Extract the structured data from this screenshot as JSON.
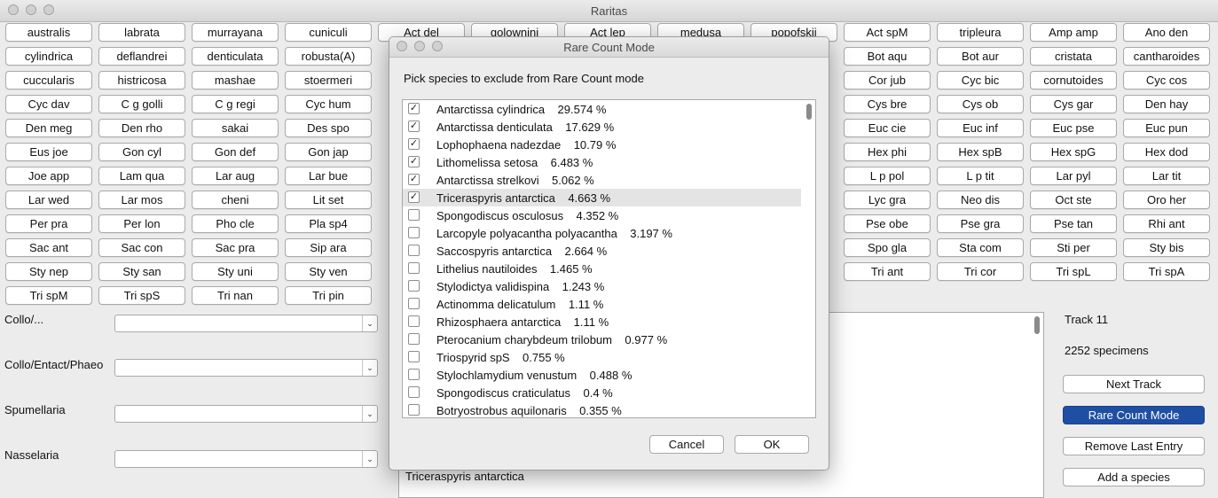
{
  "window": {
    "title": "Raritas"
  },
  "species_buttons": [
    "australis",
    "labrata",
    "murrayana",
    "cuniculi",
    "Act del",
    "golownini",
    "Act lep",
    "medusa",
    "popofskii",
    "Act spM",
    "tripleura",
    "Amp amp",
    "Ano den",
    "cylindrica",
    "deflandrei",
    "denticulata",
    "robusta(A)",
    "",
    "",
    "",
    "",
    "",
    "Bot aqu",
    "Bot aur",
    "cristata",
    "cantharoides",
    "cuccularis",
    "histricosa",
    "mashae",
    "stoermeri",
    "",
    "",
    "",
    "",
    "",
    "Cor jub",
    "Cyc bic",
    "cornutoides",
    "Cyc cos",
    "Cyc dav",
    "C g golli",
    "C g regi",
    "Cyc hum",
    "",
    "",
    "",
    "",
    "",
    "Cys bre",
    "Cys ob",
    "Cys gar",
    "Den hay",
    "Den meg",
    "Den rho",
    "sakai",
    "Des spo",
    "",
    "",
    "",
    "",
    "",
    "Euc cie",
    "Euc inf",
    "Euc pse",
    "Euc pun",
    "Eus joe",
    "Gon cyl",
    "Gon def",
    "Gon jap",
    "",
    "",
    "",
    "",
    "",
    "Hex phi",
    "Hex spB",
    "Hex spG",
    "Hex dod",
    "Joe app",
    "Lam qua",
    "Lar aug",
    "Lar bue",
    "",
    "",
    "",
    "",
    "",
    "L p pol",
    "L p tit",
    "Lar pyl",
    "Lar tit",
    "Lar wed",
    "Lar mos",
    "cheni",
    "Lit set",
    "",
    "",
    "",
    "",
    "",
    "Lyc gra",
    "Neo dis",
    "Oct ste",
    "Oro her",
    "Per pra",
    "Per lon",
    "Pho cle",
    "Pla sp4",
    "",
    "",
    "",
    "",
    "",
    "Pse obe",
    "Pse gra",
    "Pse tan",
    "Rhi ant",
    "Sac ant",
    "Sac con",
    "Sac pra",
    "Sip ara",
    "",
    "",
    "",
    "",
    "",
    "Spo gla",
    "Sta com",
    "Sti per",
    "Sty bis",
    "Sty nep",
    "Sty san",
    "Sty uni",
    "Sty ven",
    "",
    "",
    "",
    "",
    "",
    "Tri ant",
    "Tri cor",
    "Tri spL",
    "Tri spA",
    "Tri spM",
    "Tri spS",
    "Tri nan",
    "Tri pin",
    "",
    "",
    "",
    "",
    "",
    "",
    "",
    "",
    ""
  ],
  "form": {
    "fields": [
      {
        "label": "Collo/...",
        "value": ""
      },
      {
        "label": "Collo/Entact/Phaeo",
        "value": ""
      },
      {
        "label": "Spumellaria",
        "value": ""
      },
      {
        "label": "Nasselaria",
        "value": ""
      }
    ]
  },
  "log": {
    "lines": [
      "Triceraspyris antarctica"
    ]
  },
  "side": {
    "track": "Track 11",
    "specimens": "2252 specimens",
    "next_track": "Next Track",
    "rare_count_mode": "Rare Count Mode",
    "remove_last": "Remove Last Entry",
    "add_species": "Add a species"
  },
  "colors": {
    "primary_button": "#1f4fa3",
    "selected_row": "#e4e4e4"
  },
  "dialog": {
    "title": "Rare Count Mode",
    "prompt": "Pick species to exclude from Rare Count mode",
    "items": [
      {
        "label": "Antarctissa cylindrica    29.574 %",
        "checked": true
      },
      {
        "label": "Antarctissa denticulata    17.629 %",
        "checked": true
      },
      {
        "label": "Lophophaena nadezdae    10.79 %",
        "checked": true
      },
      {
        "label": "Lithomelissa setosa    6.483 %",
        "checked": true
      },
      {
        "label": "Antarctissa strelkovi    5.062 %",
        "checked": true
      },
      {
        "label": "Triceraspyris antarctica    4.663 %",
        "checked": true,
        "selected": true
      },
      {
        "label": "Spongodiscus osculosus    4.352 %",
        "checked": false
      },
      {
        "label": "Larcopyle polyacantha polyacantha    3.197 %",
        "checked": false
      },
      {
        "label": "Saccospyris antarctica    2.664 %",
        "checked": false
      },
      {
        "label": "Lithelius nautiloides    1.465 %",
        "checked": false
      },
      {
        "label": "Stylodictya validispina    1.243 %",
        "checked": false
      },
      {
        "label": "Actinomma delicatulum    1.11 %",
        "checked": false
      },
      {
        "label": "Rhizosphaera antarctica    1.11 %",
        "checked": false
      },
      {
        "label": "Pterocanium charybdeum trilobum    0.977 %",
        "checked": false
      },
      {
        "label": "Triospyrid spS    0.755 %",
        "checked": false
      },
      {
        "label": "Stylochlamydium venustum    0.488 %",
        "checked": false
      },
      {
        "label": "Spongodiscus craticulatus    0.4 %",
        "checked": false
      },
      {
        "label": "Botryostrobus aquilonaris    0.355 %",
        "checked": false
      }
    ],
    "cancel": "Cancel",
    "ok": "OK"
  }
}
